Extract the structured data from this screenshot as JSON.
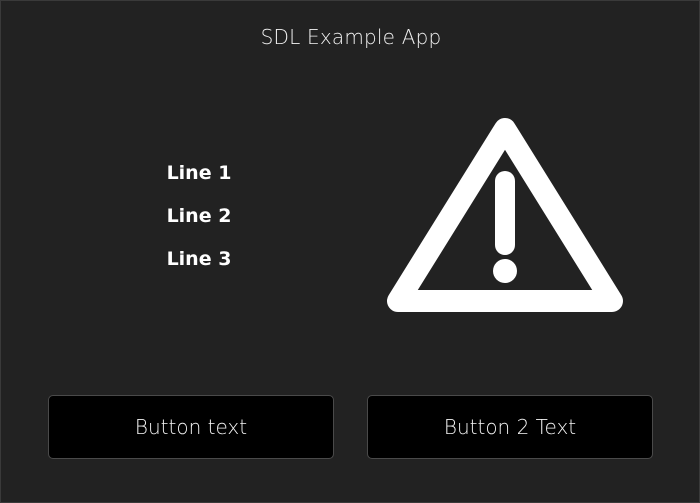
{
  "window": {
    "title": "SDL Example App"
  },
  "content": {
    "lines": [
      {
        "label": "Line 1"
      },
      {
        "label": "Line 2"
      },
      {
        "label": "Line 3"
      }
    ],
    "warning_icon": {
      "name": "warning-icon",
      "color": "#ffffff"
    }
  },
  "buttons": {
    "button1_label": "Button text",
    "button2_label": "Button 2 Text"
  },
  "colors": {
    "background": "#222222",
    "button_background": "#000000",
    "text": "#ffffff"
  }
}
